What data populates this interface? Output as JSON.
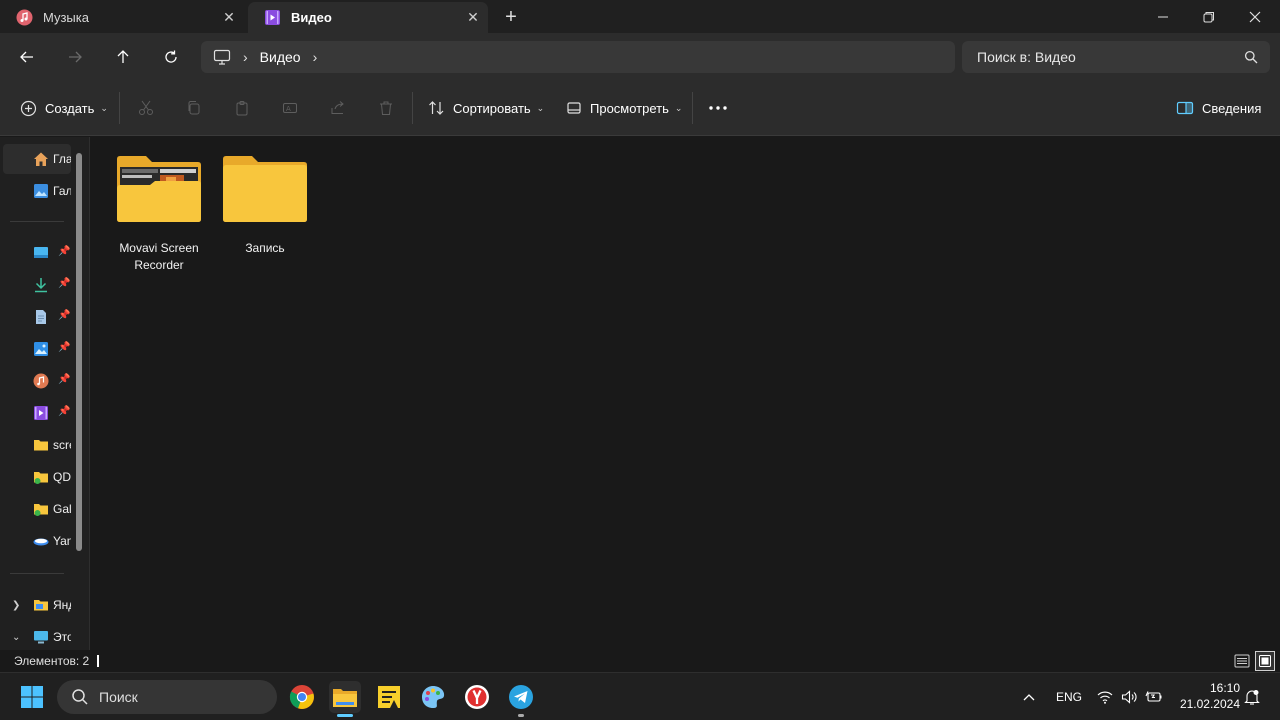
{
  "tabs": [
    {
      "label": "Музыка",
      "icon": "music-icon",
      "active": false
    },
    {
      "label": "Видео",
      "icon": "video-icon",
      "active": true
    }
  ],
  "address": {
    "crumbs": [
      "Видео"
    ],
    "search_placeholder": "Поиск в: Видео"
  },
  "commands": {
    "create": "Создать",
    "sort": "Сортировать",
    "view": "Просмотреть",
    "details": "Сведения"
  },
  "sidebar": {
    "items": [
      {
        "label": "Гла",
        "icon": "home-icon"
      },
      {
        "label": "Гал",
        "icon": "gallery-icon"
      },
      {
        "label": "",
        "icon": "desktop-icon",
        "pinned": true
      },
      {
        "label": "",
        "icon": "download-icon",
        "pinned": true
      },
      {
        "label": "",
        "icon": "documents-icon",
        "pinned": true
      },
      {
        "label": "",
        "icon": "pictures-icon",
        "pinned": true
      },
      {
        "label": "",
        "icon": "music-icon",
        "pinned": true
      },
      {
        "label": "",
        "icon": "video-icon",
        "pinned": true
      },
      {
        "label": "scre",
        "icon": "folder-icon"
      },
      {
        "label": "QD",
        "icon": "folder-icon"
      },
      {
        "label": "Gal",
        "icon": "folder-icon"
      },
      {
        "label": "Yan",
        "icon": "yandex-disk-icon"
      },
      {
        "label": "Янд",
        "icon": "folder-icon"
      },
      {
        "label": "Это",
        "icon": "this-pc-icon"
      }
    ]
  },
  "folders": [
    {
      "name": "Movavi Screen Recorder",
      "has_preview": true
    },
    {
      "name": "Запись",
      "has_preview": false
    }
  ],
  "status": {
    "items_count": "Элементов: 2"
  },
  "taskbar": {
    "search_label": "Поиск",
    "language": "ENG",
    "time": "16:10",
    "date": "21.02.2024"
  },
  "colors": {
    "folder_yellow": "#f8c63d",
    "accent": "#60cdff",
    "background": "#191919"
  }
}
